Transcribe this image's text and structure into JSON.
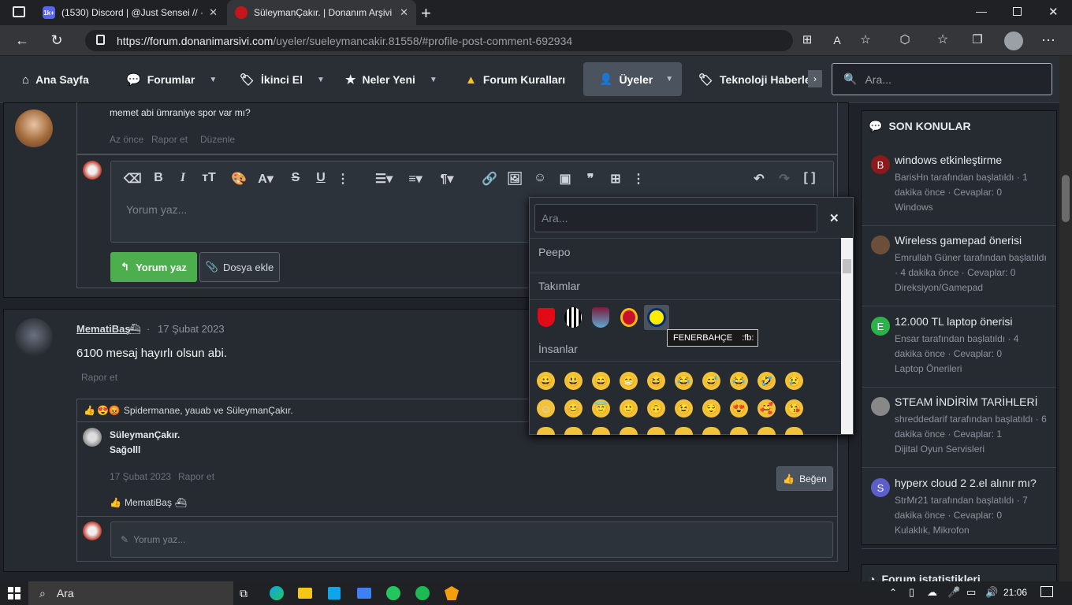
{
  "browser": {
    "tabs": [
      {
        "title": "(1530) Discord | @Just Sensei // ·",
        "badge": "1k+"
      },
      {
        "title": "SüleymanÇakır. | Donanım Arşivi",
        "active": true
      }
    ],
    "url_host": "https://forum.donanimarsivi.com",
    "url_path": "/uyeler/sueleymancakir.81558/#profile-post-comment-692934"
  },
  "nav": {
    "items": [
      "Ana Sayfa",
      "Forumlar",
      "İkinci El",
      "Neler Yeni",
      "Forum Kuralları",
      "Üyeler",
      "Teknoloji Haberle"
    ],
    "search_placeholder": "Ara..."
  },
  "post1": {
    "comment": "memet abi ümraniye spor var mı?",
    "meta": [
      "Az önce",
      "Rapor et",
      "Düzenle"
    ],
    "editor_placeholder": "Yorum yaz...",
    "reply_button": "Yorum yaz",
    "attach_button": "Dosya ekle"
  },
  "post2": {
    "author": "MematiBaş",
    "date": "17 Şubat 2023",
    "body": "6100 mesaj hayırlı olsun abi.",
    "report": "Rapor et",
    "reactions": "Spidermanae, yauab ve SüleymanÇakır.",
    "reply": {
      "author": "SüleymanÇakır.",
      "text": "Sağolll",
      "date": "17 Şubat 2023",
      "report": "Rapor et",
      "like_button": "Beğen",
      "liker": "MematiBaş"
    },
    "comment_placeholder": "Yorum yaz..."
  },
  "emoji_picker": {
    "search_placeholder": "Ara...",
    "categories": [
      "Peepo",
      "Takımlar",
      "İnsanlar"
    ],
    "tooltip_name": "FENERBAHÇE",
    "tooltip_code": ":fb:"
  },
  "sidebar": {
    "title": "SON KONULAR",
    "threads": [
      {
        "title": "windows etkinleştirme",
        "author": "BarisHn",
        "time": "1 dakika önce",
        "replies": "Cevaplar: 0",
        "forum": "Windows",
        "letter": "B",
        "color": "#8b1a1a"
      },
      {
        "title": "Wireless gamepad önerisi",
        "author": "Emrullah Güner",
        "time": "4 dakika önce",
        "replies": "Cevaplar: 0",
        "forum": "Direksiyon/Gamepad",
        "letter": "",
        "color": "#6b4f3a"
      },
      {
        "title": "12.000 TL laptop önerisi",
        "author": "Ensar",
        "time": "4 dakika önce",
        "replies": "Cevaplar: 0",
        "forum": "Laptop Önerileri",
        "letter": "E",
        "color": "#2bb34b"
      },
      {
        "title": "STEAM İNDİRİM TARİHLERİ",
        "author": "shreddedarif",
        "time": "6 dakika önce",
        "replies": "Cevaplar: 1",
        "forum": "Dijital Oyun Servisleri",
        "letter": "",
        "color": "#888"
      },
      {
        "title": "hyperx cloud 2 2.el alınır mı?",
        "author": "StrMr21",
        "time": "7 dakika önce",
        "replies": "Cevaplar: 0",
        "forum": "Kulaklık, Mikrofon",
        "letter": "S",
        "color": "#5b5fc7"
      }
    ],
    "stats_title": "Forum istatistikleri",
    "started_by": "tarafından başlatıldı"
  },
  "taskbar": {
    "search": "Ara",
    "time": "21:06"
  }
}
